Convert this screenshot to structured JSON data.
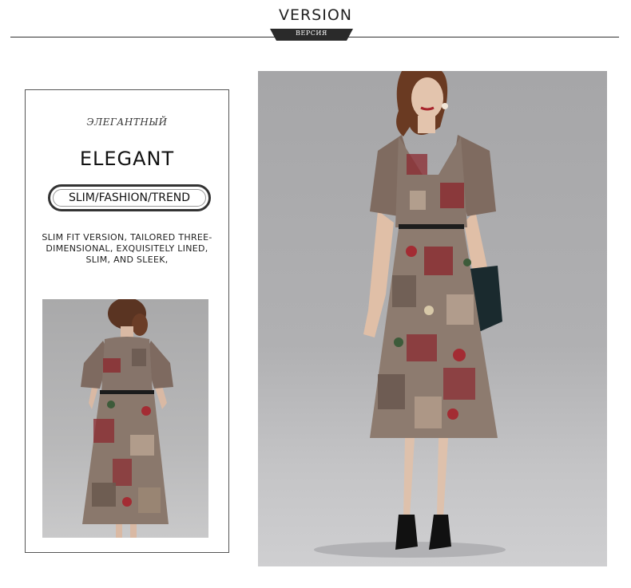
{
  "header": {
    "title": "VERSION",
    "subtitle_ru": "ВЕРСИЯ"
  },
  "card": {
    "subtitle_ru": "ЭЛЕГАНТНЫЙ",
    "title": "ELEGANT",
    "tagline": "SLIM/FASHION/TREND",
    "description_lines": [
      "SLIM FIT VERSION, TAILORED THREE-",
      "DIMENSIONAL, EXQUISITELY LINED,",
      "SLIM, AND SLEEK,"
    ]
  },
  "images": {
    "back_view": "model-back-view-photo",
    "front_view": "model-front-view-photo"
  },
  "colors": {
    "text": "#222222",
    "border": "#555555",
    "dress_base": "#8a7a70",
    "dress_accent": "#8b2a30",
    "background_photo": "#b0b0b2"
  }
}
